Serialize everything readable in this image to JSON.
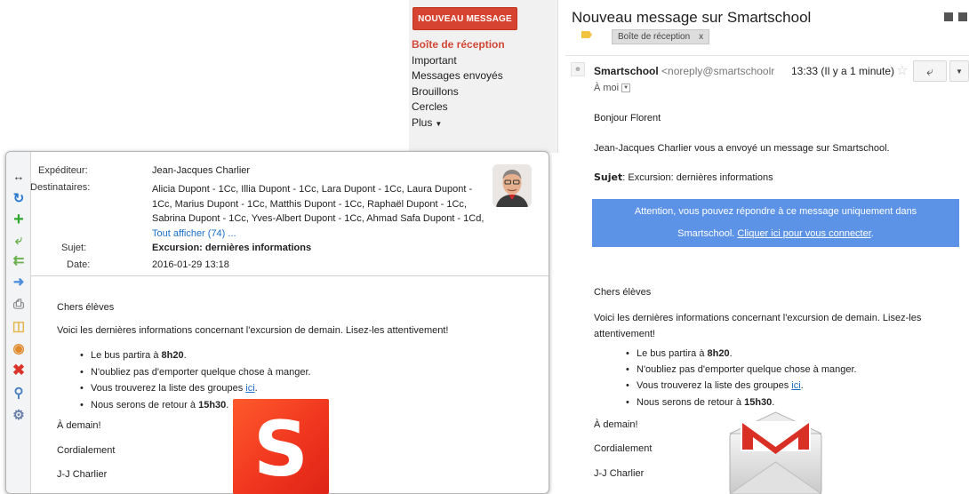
{
  "gmail": {
    "compose_label": "NOUVEAU MESSAGE",
    "labels": [
      "Boîte de réception",
      "Important",
      "Messages envoyés",
      "Brouillons",
      "Cercles",
      "Plus"
    ],
    "subject": "Nouveau message sur Smartschool",
    "label_chip": "Boîte de réception",
    "label_chip_close": "x",
    "sender_name": "Smartschool",
    "sender_email": "<noreply@smartschoolr",
    "time": "13:33 (Il y a 1 minute)",
    "to_me": "À moi",
    "greeting": "Bonjour Florent",
    "intro": "Jean-Jacques Charlier vous a envoyé un message sur Smartschool.",
    "subject_label": "Sujet",
    "subject_value": ": Excursion: dernières informations",
    "notice_line1": "Attention, vous pouvez répondre à ce message uniquement dans",
    "notice_line2_prefix": "Smartschool. ",
    "notice_link": "Cliquer ici pour vous connecter",
    "notice_line2_suffix": ".",
    "body_greeting": "Chers élèves",
    "body_par": "Voici les dernières informations concernant l'excursion de demain. Lisez-les attentivement!",
    "bullets": {
      "b1_prefix": "Le bus partira à ",
      "b1_bold": "8h20",
      "b1_suffix": ".",
      "b2": "N'oubliez pas d'emporter quelque chose à manger.",
      "b3_prefix": "Vous trouverez la liste des groupes ",
      "b3_link": "ici",
      "b3_suffix": ".",
      "b4_prefix": "Nous serons de retour à ",
      "b4_bold": "15h30",
      "b4_suffix": "."
    },
    "closing1": "À demain!",
    "closing2": "Cordialement",
    "signature": "J-J Charlier",
    "logo_icon": "gmail-envelope"
  },
  "smartschool": {
    "sender_label": "Expéditeur:",
    "sender_value": "Jean-Jacques Charlier",
    "recipients_label": "Destinataires:",
    "recipients_value": "Alicia Dupont - 1Cc, Illia Dupont - 1Cc, Lara Dupont - 1Cc, Laura Dupont - 1Cc, Marius Dupont - 1Cc, Matthis Dupont - 1Cc, Raphaël Dupont - 1Cc, Sabrina Dupont - 1Cc, Yves-Albert Dupont - 1Cc, Ahmad Safa Dupont - 1Cd, ",
    "recipients_more": "Tout afficher (74) ...",
    "subject_label": "Sujet:",
    "subject_value": "Excursion: dernières informations",
    "date_label": "Date:",
    "date_value": "2016-01-29 13:18",
    "body_greeting": "Chers élèves",
    "body_par": "Voici les dernières informations concernant l'excursion de demain. Lisez-les attentivement!",
    "bullets": {
      "b1_prefix": "Le bus partira à ",
      "b1_bold": "8h20",
      "b1_suffix": ".",
      "b2": "N'oubliez pas d'emporter quelque chose à manger.",
      "b3_prefix": "Vous trouverez la liste des groupes ",
      "b3_link": "ici",
      "b3_suffix": ".",
      "b4_prefix": "Nous serons de retour à ",
      "b4_bold": "15h30",
      "b4_suffix": "."
    },
    "closing1": "À demain!",
    "closing2": "Cordialement",
    "signature": "J-J Charlier",
    "logo_letter": "S",
    "toolbar_icons": [
      "expand-icon",
      "refresh-icon",
      "add-icon",
      "reply-icon",
      "reply-all-icon",
      "forward-icon",
      "print-icon",
      "archive-icon",
      "export-icon",
      "delete-icon",
      "search-icon",
      "settings-icon"
    ]
  },
  "colors": {
    "gmail_red": "#d64431",
    "notice_blue": "#5d93e6",
    "link_blue": "#1a6fc9",
    "smartschool_orange": "#f0361f"
  }
}
